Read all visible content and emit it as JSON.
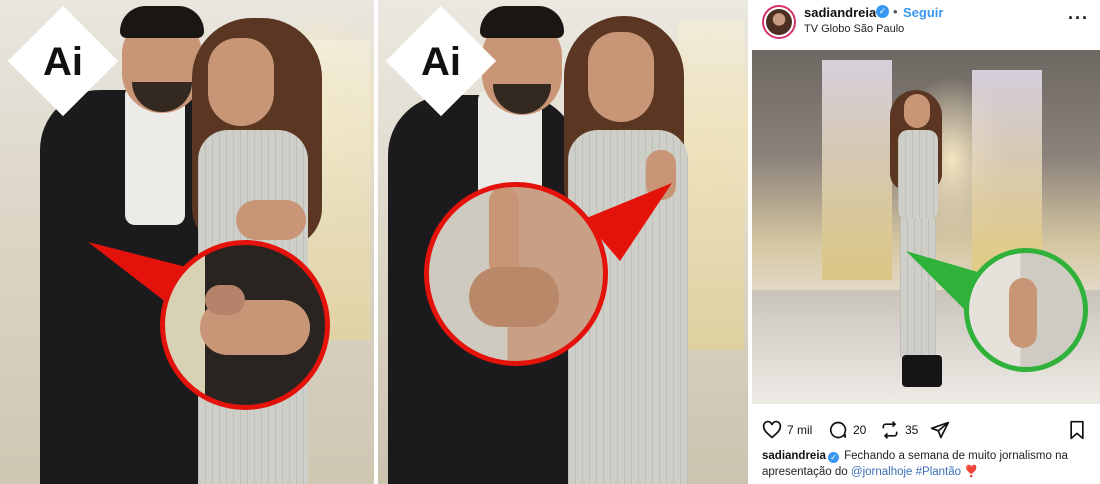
{
  "panel1": {
    "badge_text": "Ai"
  },
  "panel2": {
    "badge_text": "Ai"
  },
  "post": {
    "username": "sadiandreia",
    "separator": "•",
    "follow_label": "Seguir",
    "location": "TV Globo São Paulo",
    "more_label": "···",
    "likes": "7 mil",
    "comments": "20",
    "reposts": "35",
    "caption": {
      "user": "sadiandreia",
      "text": "Fechando a semana de muito jornalismo na apresentação do",
      "mention": "@jornalhoje",
      "hashtag": "#Plantão",
      "emoji": "❣️"
    }
  },
  "icons": {
    "badge": "ai-diamond",
    "verified": "verified-check-icon",
    "like": "heart-icon",
    "comment": "comment-icon",
    "repost": "repost-icon",
    "share": "send-icon",
    "save": "bookmark-icon",
    "more": "more-options-icon"
  },
  "colors": {
    "red_highlight": "#e3120b",
    "green_highlight": "#2fb13a",
    "ig_blue": "#3897f0",
    "link_blue": "#3b6fb6"
  }
}
